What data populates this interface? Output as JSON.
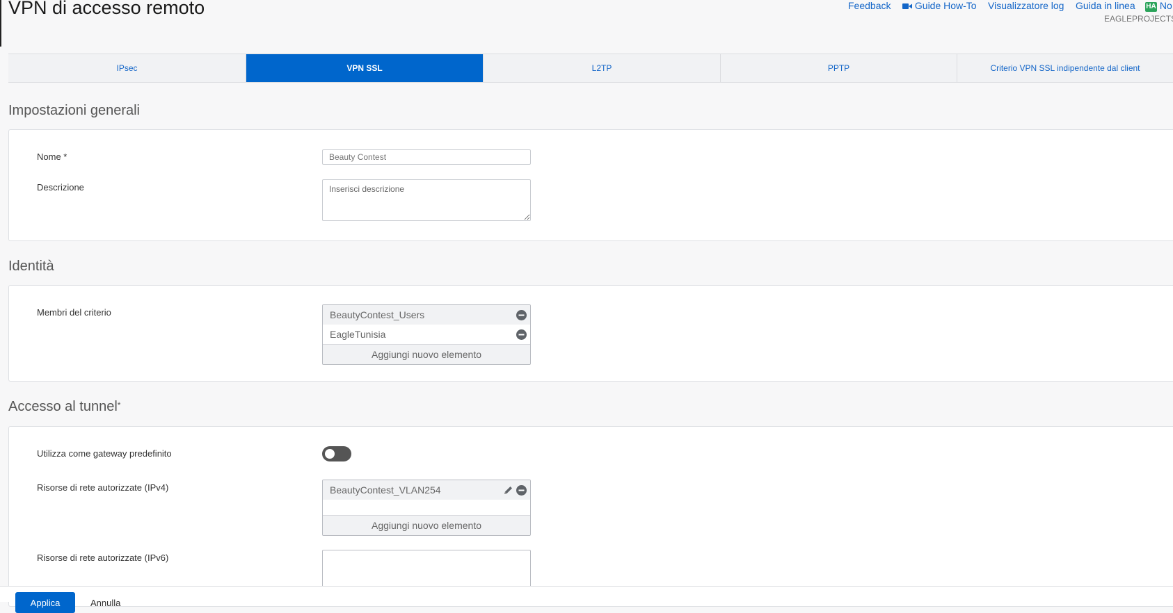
{
  "page": {
    "title": "VPN di accesso remoto"
  },
  "header": {
    "feedback": "Feedback",
    "guide_how_to": "Guide How-To",
    "log_viewer": "Visualizzatore log",
    "online_help": "Guida in linea",
    "ha_badge": "HA",
    "ha_label": "No",
    "device_name": "EAGLEPROJECTS"
  },
  "tabs": [
    {
      "label": "IPsec",
      "active": false
    },
    {
      "label": "VPN SSL",
      "active": true
    },
    {
      "label": "L2TP",
      "active": false
    },
    {
      "label": "PPTP",
      "active": false
    },
    {
      "label": "Criterio VPN SSL indipendente dal client",
      "active": false
    }
  ],
  "general": {
    "title": "Impostazioni generali",
    "name_label": "Nome *",
    "name_value": "Beauty Contest",
    "description_label": "Descrizione",
    "description_placeholder": "Inserisci descrizione"
  },
  "identity": {
    "title": "Identità",
    "members_label": "Membri del criterio",
    "members": [
      "BeautyContest_Users",
      "EagleTunisia"
    ],
    "add_label": "Aggiungi nuovo elemento"
  },
  "tunnel": {
    "title": "Accesso al tunnel",
    "required_mark": "*",
    "default_gateway_label": "Utilizza come gateway predefinito",
    "default_gateway_on": false,
    "ipv4_label": "Risorse di rete autorizzate (IPv4)",
    "ipv4_items": [
      "BeautyContest_VLAN254"
    ],
    "add_label": "Aggiungi nuovo elemento",
    "ipv6_label": "Risorse di rete autorizzate (IPv6)"
  },
  "footer": {
    "apply_label": "Applica",
    "cancel_label": "Annulla"
  },
  "colors": {
    "accent": "#0066cc",
    "link": "#1466c8",
    "ha_badge": "#2aa35a"
  },
  "icons": [
    "video-camera-icon",
    "remove-circle-icon",
    "edit-pencil-icon"
  ]
}
